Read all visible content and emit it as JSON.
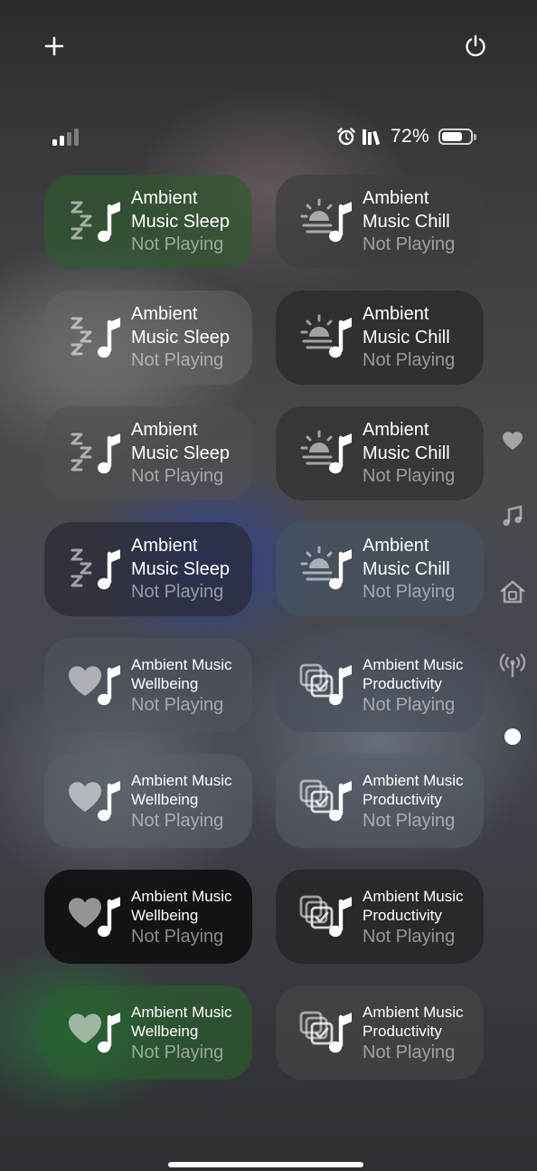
{
  "status_bar": {
    "battery_text": "72%",
    "battery_level": 0.72,
    "signal_bars_active": 2,
    "signal_bars_total": 4
  },
  "header": {
    "add_icon": "plus-icon",
    "power_icon": "power-icon"
  },
  "tiles": [
    {
      "line1": "Ambient",
      "line2": "Music Sleep",
      "status": "Not Playing",
      "icon": "sleep-music-icon",
      "bg": "rgba(45,90,45,0.62)"
    },
    {
      "line1": "Ambient",
      "line2": "Music Chill",
      "status": "Not Playing",
      "icon": "sunrise-music-icon",
      "bg": "rgba(60,62,60,0.7)"
    },
    {
      "line1": "Ambient",
      "line2": "Music Sleep",
      "status": "Not Playing",
      "icon": "sleep-music-icon",
      "bg": "rgba(100,100,102,0.55)"
    },
    {
      "line1": "Ambient",
      "line2": "Music Chill",
      "status": "Not Playing",
      "icon": "sunrise-music-icon",
      "bg": "rgba(42,42,46,0.75)"
    },
    {
      "line1": "Ambient",
      "line2": "Music Sleep",
      "status": "Not Playing",
      "icon": "sleep-music-icon",
      "bg": "rgba(80,80,84,0.6)"
    },
    {
      "line1": "Ambient",
      "line2": "Music Chill",
      "status": "Not Playing",
      "icon": "sunrise-music-icon",
      "bg": "rgba(48,48,52,0.72)"
    },
    {
      "line1": "Ambient",
      "line2": "Music Sleep",
      "status": "Not Playing",
      "icon": "sleep-music-icon",
      "bg": "rgba(40,42,52,0.7)"
    },
    {
      "line1": "Ambient",
      "line2": "Music Chill",
      "status": "Not Playing",
      "icon": "sunrise-music-icon",
      "bg": "rgba(70,85,100,0.6)"
    },
    {
      "line1": "Ambient Music",
      "line2": "Wellbeing",
      "status": "Not Playing",
      "icon": "heart-music-icon",
      "bg": "rgba(80,86,96,0.55)"
    },
    {
      "line1": "Ambient Music",
      "line2": "Productivity",
      "status": "Not Playing",
      "icon": "checklist-music-icon",
      "bg": "rgba(70,76,88,0.6)"
    },
    {
      "line1": "Ambient Music",
      "line2": "Wellbeing",
      "status": "Not Playing",
      "icon": "heart-music-icon",
      "bg": "rgba(90,96,108,0.55)"
    },
    {
      "line1": "Ambient Music",
      "line2": "Productivity",
      "status": "Not Playing",
      "icon": "checklist-music-icon",
      "bg": "rgba(85,92,104,0.55)"
    },
    {
      "line1": "Ambient Music",
      "line2": "Wellbeing",
      "status": "Not Playing",
      "icon": "heart-music-icon",
      "bg": "rgba(14,14,16,0.88)"
    },
    {
      "line1": "Ambient Music",
      "line2": "Productivity",
      "status": "Not Playing",
      "icon": "checklist-music-icon",
      "bg": "rgba(36,36,40,0.78)"
    },
    {
      "line1": "Ambient Music",
      "line2": "Wellbeing",
      "status": "Not Playing",
      "icon": "heart-music-icon",
      "bg": "rgba(40,95,45,0.62)"
    },
    {
      "line1": "Ambient Music",
      "line2": "Productivity",
      "status": "Not Playing",
      "icon": "checklist-music-icon",
      "bg": "rgba(74,70,72,0.6)"
    }
  ],
  "page_nav": [
    {
      "icon": "heart-icon"
    },
    {
      "icon": "music-note-icon"
    },
    {
      "icon": "home-icon"
    },
    {
      "icon": "antenna-icon"
    },
    {
      "icon": "page-dot-icon"
    }
  ]
}
